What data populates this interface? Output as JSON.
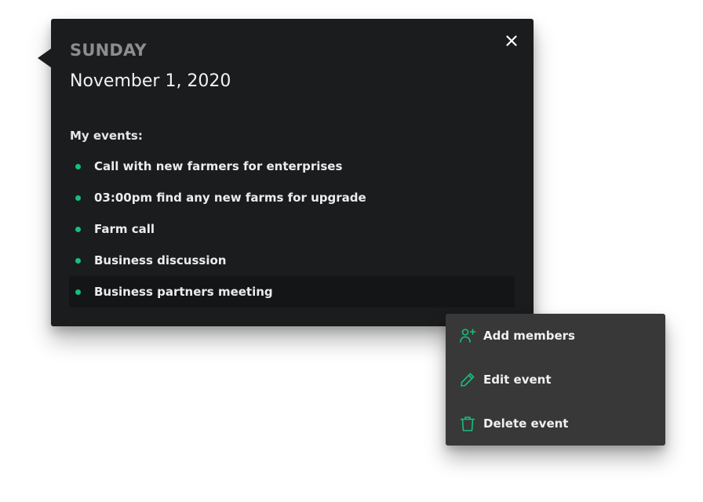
{
  "popover": {
    "day": "SUNDAY",
    "date": "November 1, 2020",
    "events_heading": "My events:",
    "events": [
      {
        "label": "Call with new farmers for enterprises"
      },
      {
        "label": "03:00pm find any new farms for upgrade"
      },
      {
        "label": "Farm call"
      },
      {
        "label": "Business discussion"
      },
      {
        "label": "Business partners meeting",
        "selected": true
      }
    ],
    "close_icon": "close-icon"
  },
  "context_menu": {
    "items": [
      {
        "label": "Add members",
        "icon": "add-user-icon"
      },
      {
        "label": "Edit event",
        "icon": "pencil-icon"
      },
      {
        "label": "Delete event",
        "icon": "trash-icon"
      }
    ]
  },
  "colors": {
    "popover_bg": "#1b1c1e",
    "menu_bg": "#383838",
    "accent_green": "#14c07b",
    "muted_text": "#8b8d90",
    "primary_text": "#f2f2f2"
  }
}
